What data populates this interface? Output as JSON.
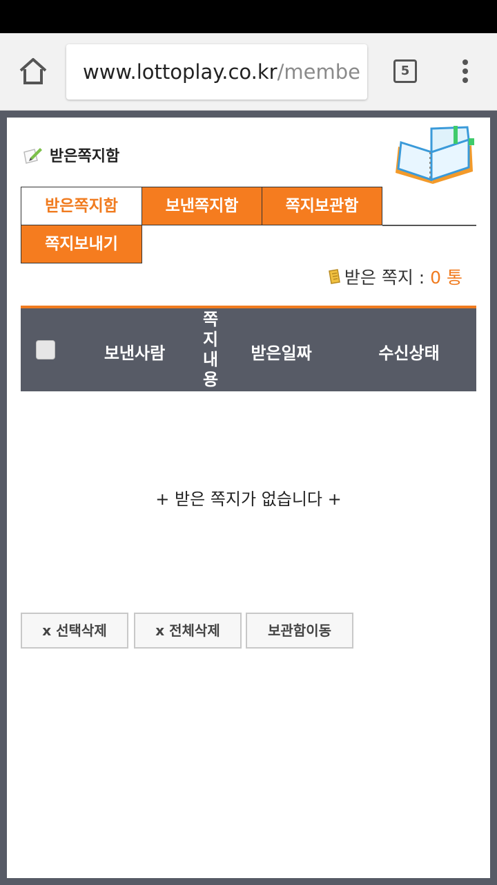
{
  "browser": {
    "url_host": "www.lottoplay.co.kr",
    "url_path": "/membe",
    "tab_count": "5"
  },
  "page": {
    "title": "받은쪽지함",
    "tabs": [
      {
        "label": "받은쪽지함",
        "active": true
      },
      {
        "label": "보낸쪽지함",
        "active": false
      },
      {
        "label": "쪽지보관함",
        "active": false
      },
      {
        "label": "쪽지보내기",
        "active": false
      }
    ],
    "count_label": "받은 쪽지 : ",
    "count_value": "0 통",
    "table": {
      "headers": [
        "보낸사람",
        "쪽지내용",
        "받은일짜",
        "수신상태"
      ]
    },
    "empty_message": "+ 받은 쪽지가 없습니다 +",
    "buttons": [
      "x 선택삭제",
      "x 전체삭제",
      "보관함이동"
    ]
  },
  "colors": {
    "accent": "#f57c1f",
    "header_bg": "#575b66"
  }
}
